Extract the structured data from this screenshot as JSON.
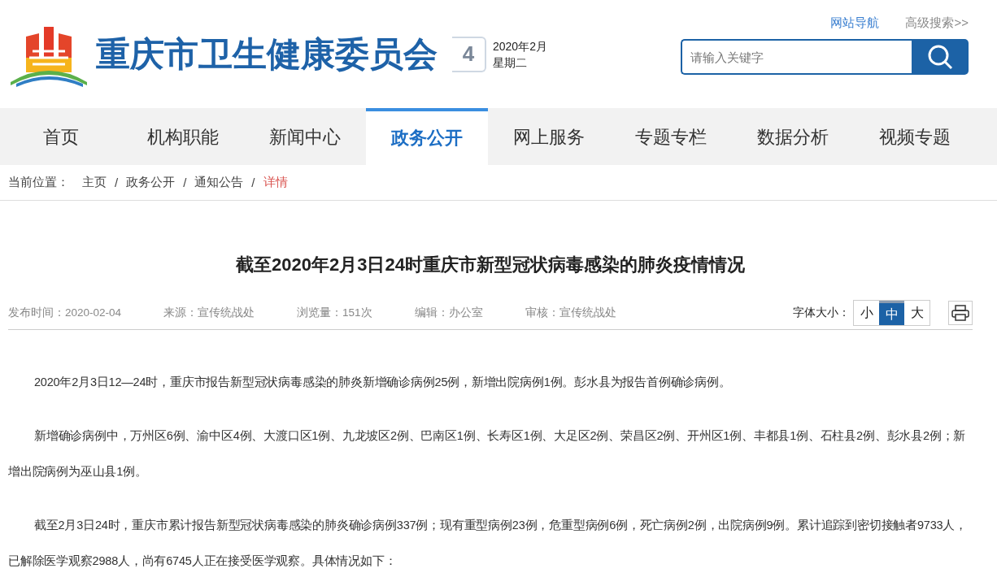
{
  "header": {
    "site_title": "重庆市卫生健康委员会",
    "date_day": "4",
    "date_month": "2020年2月",
    "weekday": "星期二",
    "links": [
      {
        "label": "网站导航",
        "kind": "primary"
      },
      {
        "label": "高级搜索>>",
        "kind": "secondary"
      }
    ],
    "search": {
      "placeholder": "请输入关键字"
    }
  },
  "nav": [
    {
      "label": "首页",
      "selected": false
    },
    {
      "label": "机构职能",
      "selected": false
    },
    {
      "label": "新闻中心",
      "selected": false
    },
    {
      "label": "政务公开",
      "selected": true
    },
    {
      "label": "网上服务",
      "selected": false
    },
    {
      "label": "专题专栏",
      "selected": false
    },
    {
      "label": "数据分析",
      "selected": false
    },
    {
      "label": "视频专题",
      "selected": false
    }
  ],
  "breadcrumb": {
    "label": "当前位置：",
    "separator": "/",
    "items": [
      {
        "label": "主页",
        "current": false
      },
      {
        "label": "政务公开",
        "current": false
      },
      {
        "label": "通知公告",
        "current": false
      },
      {
        "label": "详情",
        "current": true
      }
    ]
  },
  "article": {
    "title": "截至2020年2月3日24时重庆市新型冠状病毒感染的肺炎疫情情况",
    "meta": [
      "发布时间：2020-02-04",
      "来源：宣传统战处",
      "浏览量：151次",
      "编辑：办公室",
      "审核：宣传统战处"
    ],
    "font_size": {
      "label": "字体大小：",
      "options": [
        {
          "label": "小",
          "selected": false
        },
        {
          "label": "中",
          "selected": true
        },
        {
          "label": "大",
          "selected": false
        }
      ]
    },
    "paragraphs": [
      "2020年2月3日12—24时，重庆市报告新型冠状病毒感染的肺炎新增确诊病例25例，新增出院病例1例。彭水县为报告首例确诊病例。",
      "新增确诊病例中，万州区6例、渝中区4例、大渡口区1例、九龙坡区2例、巴南区1例、长寿区1例、大足区2例、荣昌区2例、开州区1例、丰都县1例、石柱县2例、彭水县2例；新增出院病例为巫山县1例。",
      "截至2月3日24时，重庆市累计报告新型冠状病毒感染的肺炎确诊病例337例；现有重型病例23例，危重型病例6例，死亡病例2例，出院病例9例。累计追踪到密切接触者9733人，已解除医学观察2988人，尚有6745人正在接受医学观察。具体情况如下："
    ]
  }
}
